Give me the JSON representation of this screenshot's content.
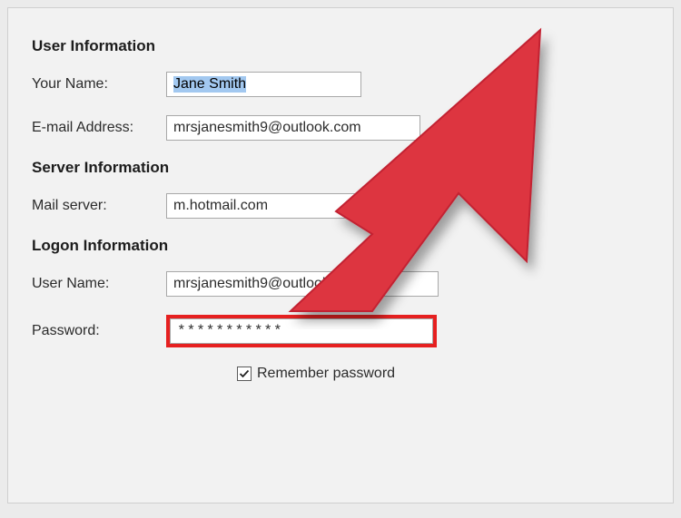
{
  "sections": {
    "user": {
      "heading": "User Information",
      "your_name_label": "Your Name:",
      "your_name_value": "Jane Smith",
      "email_label": "E-mail Address:",
      "email_value": "mrsjanesmith9@outlook.com"
    },
    "server": {
      "heading": "Server Information",
      "mail_server_label": "Mail server:",
      "mail_server_value": "m.hotmail.com"
    },
    "logon": {
      "heading": "Logon Information",
      "username_label": "User Name:",
      "username_value": "mrsjanesmith9@outlook.com",
      "password_label": "Password:",
      "password_value": "***********",
      "remember_label": "Remember password",
      "remember_checked": true
    }
  }
}
